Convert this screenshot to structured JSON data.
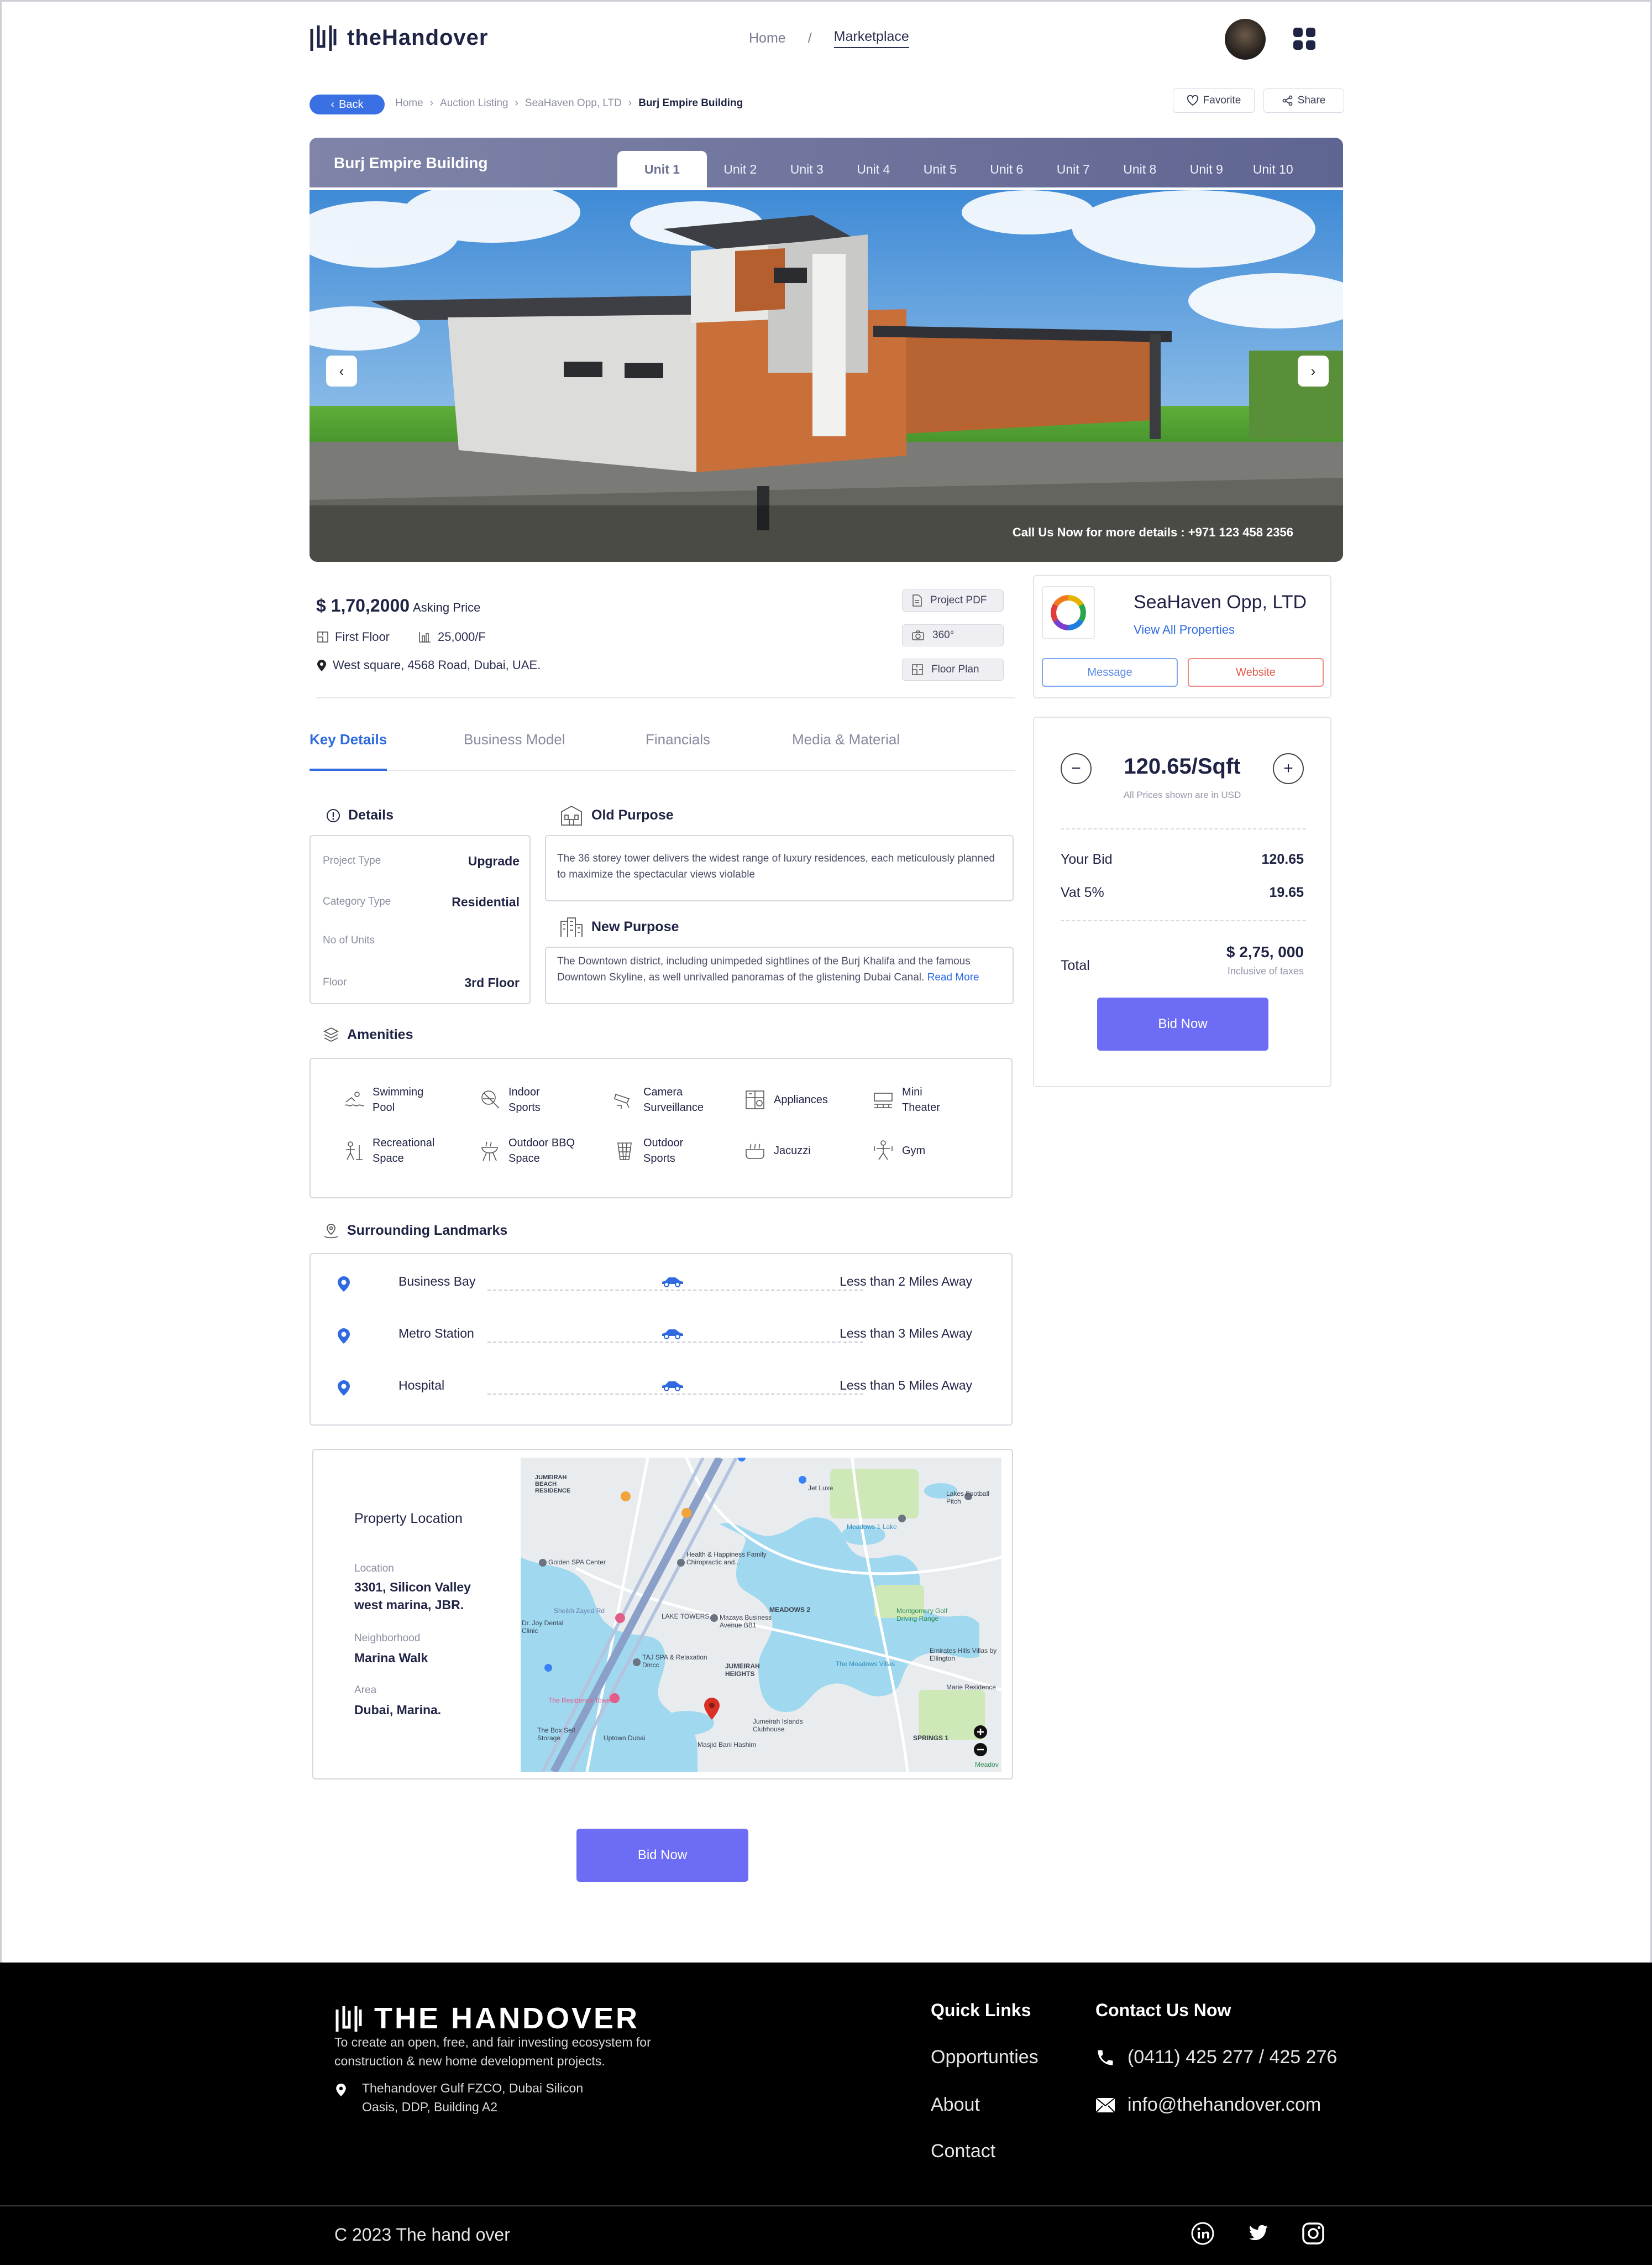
{
  "header": {
    "brand": "theHandover",
    "nav": [
      "Home",
      "/",
      "Marketplace"
    ]
  },
  "breadcrumb": {
    "back": "Back",
    "items": [
      "Home",
      "›",
      "Auction Listing",
      "›",
      "SeaHaven Opp, LTD",
      "›",
      "Burj Empire Building"
    ],
    "favorite": "Favorite",
    "share": "Share"
  },
  "hero": {
    "title": "Burj Empire Building",
    "tabs": [
      "Unit 1",
      "Unit 2",
      "Unit 3",
      "Unit 4",
      "Unit 5",
      "Unit 6",
      "Unit 7",
      "Unit 8",
      "Unit 9",
      "Unit 10"
    ],
    "active_tab": 0,
    "call": "Call Us Now for more details : +971 123 458 2356"
  },
  "listing": {
    "price": "$ 1,70,2000",
    "price_label": "Asking Price",
    "floor": "First Floor",
    "area": "25,000/F",
    "address": "West square, 4568 Road, Dubai, UAE.",
    "docs": [
      "Project PDF",
      "360°",
      "Floor Plan"
    ]
  },
  "seller": {
    "name": "SeaHaven Opp, LTD",
    "view_all": "View All Properties",
    "message": "Message",
    "website": "Website"
  },
  "bid": {
    "rate": "120.65/Sqft",
    "note": "All Prices shown are in USD",
    "your_bid_label": "Your Bid",
    "your_bid": "120.65",
    "vat_label": "Vat 5%",
    "vat": "19.65",
    "total_label": "Total",
    "total": "$ 2,75, 000",
    "inclusive": "Inclusive of taxes",
    "button": "Bid Now"
  },
  "tabs": [
    "Key Details",
    "Business Model",
    "Financials",
    "Media & Material"
  ],
  "details": {
    "title": "Details",
    "rows": [
      {
        "label": "Project Type",
        "value": "Upgrade"
      },
      {
        "label": "Category Type",
        "value": "Residential"
      },
      {
        "label": "No of Units",
        "value": ""
      },
      {
        "label": "Floor",
        "value": "3rd Floor"
      }
    ]
  },
  "old_purpose": {
    "title": "Old Purpose",
    "text": "The 36 storey tower delivers the widest range of luxury residences, each meticulously planned to maximize the spectacular views violable"
  },
  "new_purpose": {
    "title": "New Purpose",
    "text": "The Downtown district, including unimpeded sightlines of the Burj Khalifa and the famous Downtown Skyline, as well unrivalled  panoramas of the glistening Dubai Canal.",
    "more": "Read More"
  },
  "amenities": {
    "title": "Amenities",
    "items": [
      [
        "Swimming",
        "Pool"
      ],
      [
        "Indoor",
        "Sports"
      ],
      [
        "Camera",
        "Surveillance"
      ],
      [
        "Appliances",
        ""
      ],
      [
        "Mini",
        "Theater"
      ],
      [
        "Recreational",
        "Space"
      ],
      [
        "Outdoor BBQ",
        "Space"
      ],
      [
        "Outdoor",
        "Sports"
      ],
      [
        "Jacuzzi",
        ""
      ],
      [
        "Gym",
        ""
      ]
    ]
  },
  "landmarks": {
    "title": "Surrounding Landmarks",
    "items": [
      {
        "name": "Business Bay",
        "distance": "Less than 2 Miles Away"
      },
      {
        "name": "Metro Station",
        "distance": "Less than 3 Miles Away"
      },
      {
        "name": "Hospital",
        "distance": "Less than 5 Miles Away"
      }
    ]
  },
  "location": {
    "title": "Property Location",
    "location_label": "Location",
    "location": "3301, Silicon Valley west marina, JBR.",
    "neighborhood_label": "Neighborhood",
    "neighborhood": "Marina Walk",
    "area_label": "Area",
    "area": "Dubai, Marina.",
    "map_labels": [
      "JUMEIRAH BEACH RESIDENCE",
      "Jet Luxe",
      "Meadows 1 Lake",
      "Lakes Football Pitch",
      "Golden SPA Center",
      "Health & Happiness Family Chiropractic and...",
      "MEADOWS 2",
      "Sheikh Zayed Rd",
      "Dr. Joy Dental Clinic",
      "LAKE TOWERS",
      "Mazaya Business Avenue BB1",
      "Montgomery Golf Driving Range",
      "TAJ SPA & Relaxation Dmcc",
      "JUMEIRAH HEIGHTS",
      "The Meadows Villas",
      "Emirates Hills Villas by Ellington",
      "Marie Residence",
      "The Residence Tower",
      "Jumeirah Islands Clubhouse",
      "SPRINGS 1",
      "The Box Self Storage",
      "Uptown Dubai",
      "Masjid Bani Hashim",
      "Meadov"
    ]
  },
  "footer": {
    "brand": "THE HANDOVER",
    "desc": "To create an open, free, and fair investing ecosystem for construction & new home development projects.",
    "address": "Thehandover Gulf FZCO, Dubai Silicon Oasis, DDP, Building A2",
    "quick_links_title": "Quick Links",
    "quick_links": [
      "Opportunties",
      "About",
      "Contact"
    ],
    "contact_title": "Contact Us Now",
    "phone": "(0411) 425 277 / 425 276",
    "email": "info@thehandover.com",
    "copyright": "C  2023 The hand over"
  }
}
